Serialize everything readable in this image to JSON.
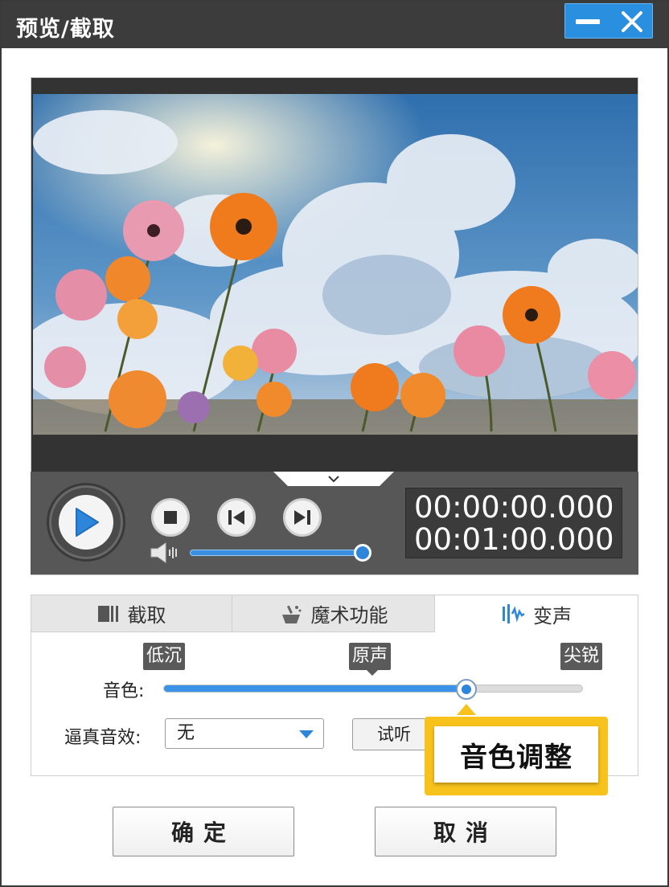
{
  "window": {
    "title": "预览/截取"
  },
  "player": {
    "current_time": "00:00:00.000",
    "total_time": "00:01:00.000",
    "seek_progress": 0.0,
    "volume": 0.95
  },
  "tabs": [
    {
      "label": "截取",
      "icon": "cut-icon"
    },
    {
      "label": "魔术功能",
      "icon": "magic-wand-icon"
    },
    {
      "label": "变声",
      "icon": "sound-wave-icon",
      "active": true
    }
  ],
  "voice": {
    "tone_label": "音色:",
    "marker_low": "低沉",
    "marker_original": "原声",
    "marker_sharp": "尖锐",
    "tone_value": 0.74,
    "effect_label": "逼真音效:",
    "effect_selected": "无",
    "listen_label": "试听"
  },
  "annotation": {
    "text": "音色调整"
  },
  "buttons": {
    "ok": "确定",
    "cancel": "取消"
  },
  "colors": {
    "accent": "#2d86da",
    "callout": "#f7c21b",
    "titlebar": "#3c3c3c"
  }
}
